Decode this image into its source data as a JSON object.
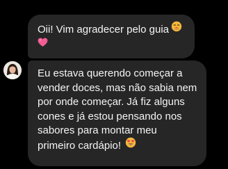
{
  "messages": [
    {
      "lines": [
        "Oii! Vim agradecer pelo guia",
        ""
      ],
      "emojis": [
        "face-with-hand-over-mouth-emoji",
        "pink-heart-emoji"
      ]
    },
    {
      "lines": [
        "Eu estava querendo começar a",
        "vender doces, mas não sabia nem",
        "por onde começar. Já fiz alguns",
        "cones e já estou pensando nos",
        "sabores para montar meu",
        "primeiro cardápio!"
      ],
      "emojis": [
        "smiling-face-with-heart-eyes-emoji"
      ]
    }
  ],
  "colors": {
    "background": "#000000",
    "bubble": "#262626",
    "text": "#f5f5f5"
  }
}
